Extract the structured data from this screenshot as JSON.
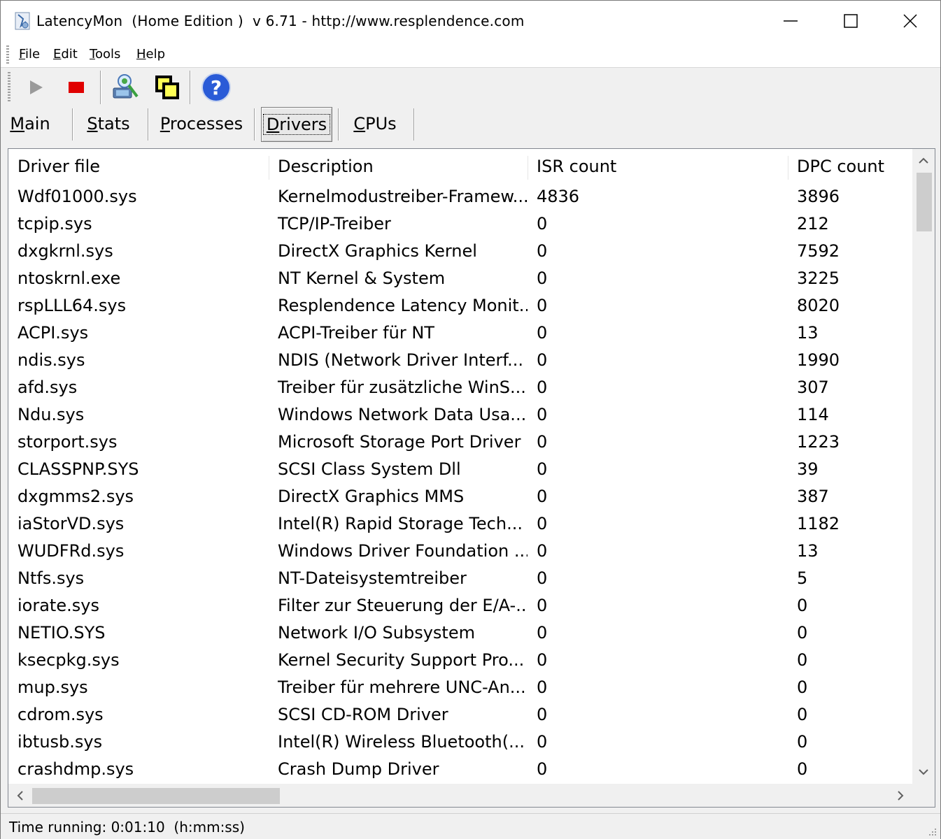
{
  "window": {
    "title": "LatencyMon  (Home Edition )  v 6.71 - http://www.resplendence.com"
  },
  "menu": {
    "items": [
      {
        "key": "F",
        "rest": "ile"
      },
      {
        "key": "E",
        "rest": "dit"
      },
      {
        "key": "T",
        "rest": "ools"
      },
      {
        "key": "H",
        "rest": "elp"
      }
    ]
  },
  "toolbar": {
    "icons": [
      "play-icon",
      "stop-icon",
      "cpu-test-icon",
      "windows-icon",
      "help-icon"
    ]
  },
  "tabs": [
    {
      "key": "M",
      "rest": "ain"
    },
    {
      "key": "S",
      "rest": "tats"
    },
    {
      "key": "P",
      "rest": "rocesses"
    },
    {
      "key": "D",
      "rest": "rivers"
    },
    {
      "key": "C",
      "rest": "PUs"
    }
  ],
  "active_tab": "Drivers",
  "table": {
    "columns": [
      "Driver file",
      "Description",
      "ISR count",
      "DPC count"
    ],
    "rows": [
      [
        "Wdf01000.sys",
        "Kernelmodustreiber-Framew...",
        "4836",
        "3896"
      ],
      [
        "tcpip.sys",
        "TCP/IP-Treiber",
        "0",
        "212"
      ],
      [
        "dxgkrnl.sys",
        "DirectX Graphics Kernel",
        "0",
        "7592"
      ],
      [
        "ntoskrnl.exe",
        "NT Kernel & System",
        "0",
        "3225"
      ],
      [
        "rspLLL64.sys",
        "Resplendence Latency Monit...",
        "0",
        "8020"
      ],
      [
        "ACPI.sys",
        "ACPI-Treiber für NT",
        "0",
        "13"
      ],
      [
        "ndis.sys",
        "NDIS (Network Driver Interf...",
        "0",
        "1990"
      ],
      [
        "afd.sys",
        "Treiber für zusätzliche WinS...",
        "0",
        "307"
      ],
      [
        "Ndu.sys",
        "Windows Network Data Usa...",
        "0",
        "114"
      ],
      [
        "storport.sys",
        "Microsoft Storage Port Driver",
        "0",
        "1223"
      ],
      [
        "CLASSPNP.SYS",
        "SCSI Class System Dll",
        "0",
        "39"
      ],
      [
        "dxgmms2.sys",
        "DirectX Graphics MMS",
        "0",
        "387"
      ],
      [
        "iaStorVD.sys",
        "Intel(R) Rapid Storage Tech...",
        "0",
        "1182"
      ],
      [
        "WUDFRd.sys",
        "Windows Driver Foundation ...",
        "0",
        "13"
      ],
      [
        "Ntfs.sys",
        "NT-Dateisystemtreiber",
        "0",
        "5"
      ],
      [
        "iorate.sys",
        "Filter zur Steuerung der E/A-...",
        "0",
        "0"
      ],
      [
        "NETIO.SYS",
        "Network I/O Subsystem",
        "0",
        "0"
      ],
      [
        "ksecpkg.sys",
        "Kernel Security Support Pro...",
        "0",
        "0"
      ],
      [
        "mup.sys",
        "Treiber für mehrere UNC-An...",
        "0",
        "0"
      ],
      [
        "cdrom.sys",
        "SCSI CD-ROM Driver",
        "0",
        "0"
      ],
      [
        "ibtusb.sys",
        "Intel(R) Wireless Bluetooth(...",
        "0",
        "0"
      ],
      [
        "crashdmp.sys",
        "Crash Dump Driver",
        "0",
        "0"
      ]
    ]
  },
  "status": {
    "text": "Time running: 0:01:10  (h:mm:ss)"
  },
  "colors": {
    "stop": "#e00000",
    "help": "#2a5bd7",
    "window_bg": "#f0f0f0"
  }
}
